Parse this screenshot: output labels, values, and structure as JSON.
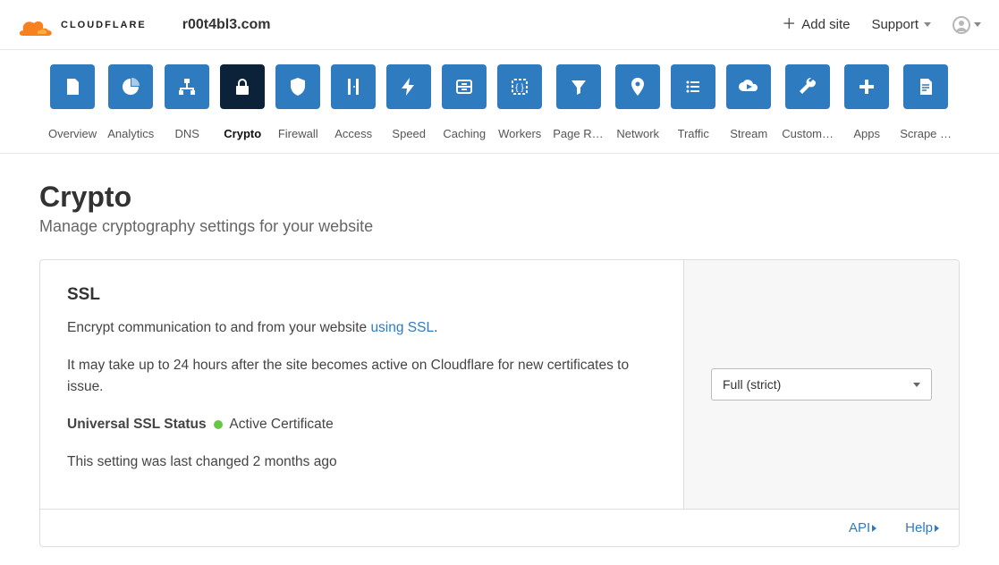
{
  "header": {
    "logo_word": "CLOUDFLARE",
    "site_name": "r00t4bl3.com",
    "add_site_label": "Add site",
    "support_label": "Support"
  },
  "nav": {
    "items": [
      {
        "id": "overview",
        "label": "Overview",
        "icon": "doc"
      },
      {
        "id": "analytics",
        "label": "Analytics",
        "icon": "pie"
      },
      {
        "id": "dns",
        "label": "DNS",
        "icon": "sitemap"
      },
      {
        "id": "crypto",
        "label": "Crypto",
        "icon": "lock",
        "active": true
      },
      {
        "id": "firewall",
        "label": "Firewall",
        "icon": "shield"
      },
      {
        "id": "access",
        "label": "Access",
        "icon": "door"
      },
      {
        "id": "speed",
        "label": "Speed",
        "icon": "bolt"
      },
      {
        "id": "caching",
        "label": "Caching",
        "icon": "drawer"
      },
      {
        "id": "workers",
        "label": "Workers",
        "icon": "braces"
      },
      {
        "id": "page-rules",
        "label": "Page Rules",
        "icon": "funnel"
      },
      {
        "id": "network",
        "label": "Network",
        "icon": "pin"
      },
      {
        "id": "traffic",
        "label": "Traffic",
        "icon": "list"
      },
      {
        "id": "stream",
        "label": "Stream",
        "icon": "cloud-play"
      },
      {
        "id": "custom-p",
        "label": "Custom P…",
        "icon": "wrench"
      },
      {
        "id": "apps",
        "label": "Apps",
        "icon": "plus"
      },
      {
        "id": "scrape-s",
        "label": "Scrape S…",
        "icon": "doc-lines"
      }
    ]
  },
  "page": {
    "title": "Crypto",
    "subtitle": "Manage cryptography settings for your website"
  },
  "card": {
    "title": "SSL",
    "desc_pre": "Encrypt communication to and from your website ",
    "desc_link": "using SSL",
    "desc_post": ".",
    "note": "It may take up to 24 hours after the site becomes active on Cloudflare for new certificates to issue.",
    "status_label": "Universal SSL Status",
    "status_value": "Active Certificate",
    "meta": "This setting was last changed 2 months ago",
    "select_value": "Full (strict)",
    "footer": {
      "api": "API",
      "help": "Help"
    }
  }
}
